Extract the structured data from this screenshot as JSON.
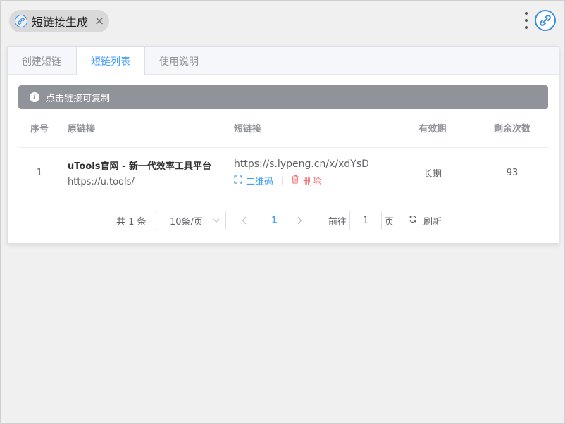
{
  "plugin": {
    "title": "短链接生成",
    "close_label": "×"
  },
  "tabs": [
    {
      "label": "创建短链"
    },
    {
      "label": "短链列表"
    },
    {
      "label": "使用说明"
    }
  ],
  "alert": {
    "text": "点击链接可复制"
  },
  "table": {
    "headers": {
      "index": "序号",
      "original": "原链接",
      "short": "短链接",
      "expiry": "有效期",
      "remaining": "剩余次数"
    },
    "rows": [
      {
        "index": "1",
        "title": "uTools官网 - 新一代效率工具平台",
        "url": "https://u.tools/",
        "short_url": "https://s.lypeng.cn/x/xdYsD",
        "qr_label": "二维码",
        "delete_label": "删除",
        "expiry": "长期",
        "remaining": "93"
      }
    ]
  },
  "pagination": {
    "total": "共 1 条",
    "page_size": "10条/页",
    "current_page": "1",
    "goto_label": "前往",
    "goto_value": "1",
    "page_unit": "页",
    "refresh_label": "刷新"
  },
  "colors": {
    "accent": "#409eff",
    "danger": "#f56c6c",
    "alert_bg": "#909399"
  }
}
